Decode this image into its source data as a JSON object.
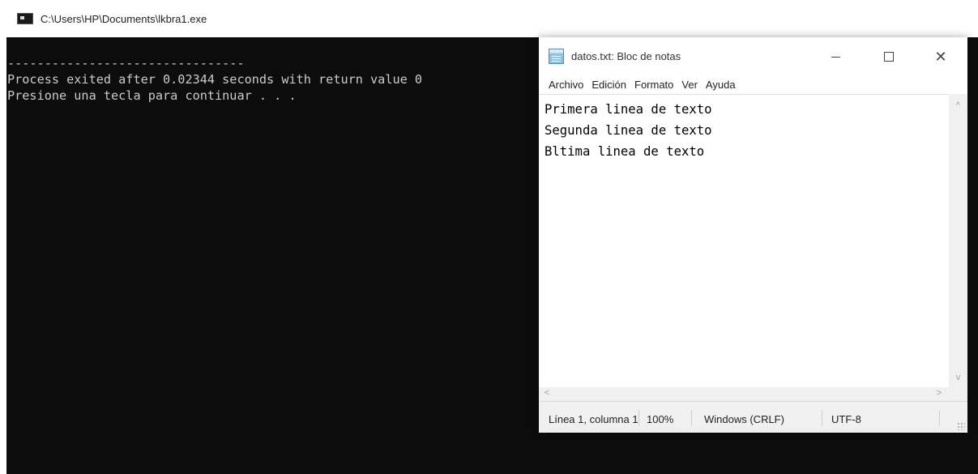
{
  "console": {
    "title": "C:\\Users\\HP\\Documents\\lkbra1.exe",
    "lines": [
      "--------------------------------",
      "Process exited after 0.02344 seconds with return value 0",
      "Presione una tecla para continuar . . ."
    ]
  },
  "notepad": {
    "title": "datos.txt: Bloc de notas",
    "controls": {
      "minimize": "—",
      "maximize": "☐",
      "close": "✕"
    },
    "menu": [
      "Archivo",
      "Edición",
      "Formato",
      "Ver",
      "Ayuda"
    ],
    "content_lines": [
      "Primera linea de texto",
      "Segunda linea de texto",
      "Bltima linea de texto"
    ],
    "scroll_arrows": {
      "up": "^",
      "down": "v",
      "left": "<",
      "right": ">"
    },
    "status": {
      "position": "Línea 1, columna 1",
      "zoom": "100%",
      "line_ending": "Windows (CRLF)",
      "encoding": "UTF-8"
    }
  },
  "icons": {
    "console": "console-window-icon",
    "notepad": "notepad-icon"
  }
}
